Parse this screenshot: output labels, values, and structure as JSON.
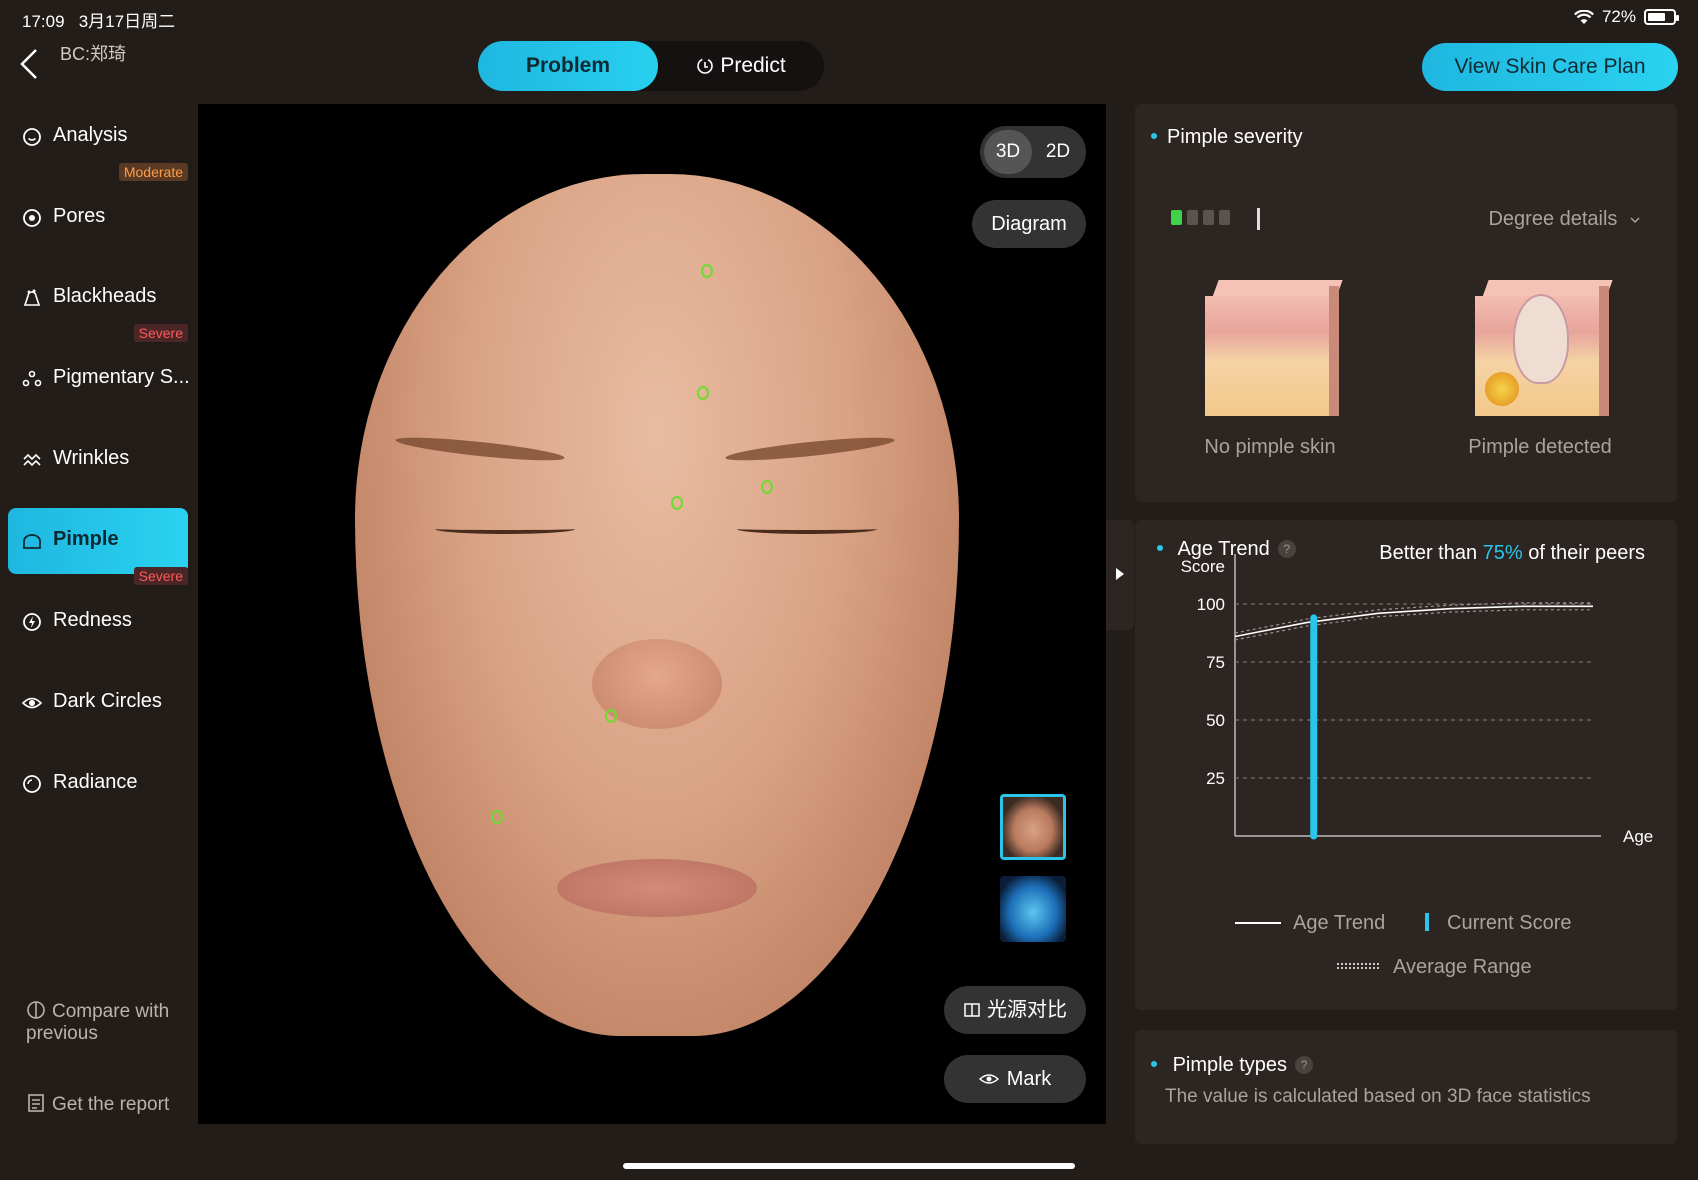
{
  "status": {
    "time": "17:09",
    "date": "3月17日周二",
    "battery": "72%",
    "battery_level": 0.72
  },
  "header": {
    "customer": "BC:郑琦",
    "tabs": [
      {
        "label": "Problem"
      },
      {
        "label": "Predict"
      }
    ],
    "plan_button": "View Skin Care Plan"
  },
  "sidebar": {
    "items": [
      {
        "label": "Analysis",
        "icon": "face-smile-icon",
        "badge": ""
      },
      {
        "label": "Pores",
        "icon": "pores-icon",
        "badge": "Moderate"
      },
      {
        "label": "Blackheads",
        "icon": "blackheads-icon",
        "badge": ""
      },
      {
        "label": "Pigmentary S...",
        "icon": "pigment-icon",
        "badge": "Severe"
      },
      {
        "label": "Wrinkles",
        "icon": "wrinkles-icon",
        "badge": ""
      },
      {
        "label": "Pimple",
        "icon": "pimple-icon",
        "badge": ""
      },
      {
        "label": "Redness",
        "icon": "redness-icon",
        "badge": "Severe"
      },
      {
        "label": "Dark Circles",
        "icon": "eye-icon",
        "badge": ""
      },
      {
        "label": "Radiance",
        "icon": "radiance-icon",
        "badge": ""
      }
    ],
    "compare": "Compare with previous",
    "report": "Get the report"
  },
  "viewer": {
    "mode_3d": "3D",
    "mode_2d": "2D",
    "diagram": "Diagram",
    "light_compare": "光源对比",
    "mark": "Mark"
  },
  "severity": {
    "title": "Pimple severity",
    "level": 1,
    "levels": 4,
    "degree_details": "Degree details",
    "no_pimple": "No pimple skin",
    "pimple_detected": "Pimple detected"
  },
  "age_trend": {
    "title": "Age Trend",
    "help": "?",
    "better_prefix": "Better than ",
    "better_pct": "75%",
    "better_suffix": " of their peers",
    "legend_trend": "Age Trend",
    "legend_current": "Current Score",
    "legend_range": "Average Range"
  },
  "chart_data": {
    "type": "line",
    "ylabel": "Score",
    "xlabel": "Age",
    "xlim": [
      20,
      70
    ],
    "ylim": [
      0,
      100
    ],
    "xticks": [
      "20",
      "30",
      "40",
      "50",
      "60",
      "70"
    ],
    "yticks": [
      "25",
      "50",
      "75",
      "100"
    ],
    "series": [
      {
        "name": "Age Trend",
        "x": [
          20,
          25,
          30,
          40,
          50,
          60,
          70
        ],
        "values": [
          86,
          89,
          92,
          96,
          98,
          99,
          99
        ]
      }
    ],
    "current_score": {
      "x": 31,
      "value": 94
    },
    "colors": {
      "current": "#29c6ea",
      "trend": "#ffffff",
      "range": "#9a928e"
    }
  },
  "types": {
    "title": "Pimple types",
    "help": "?",
    "description": "The value is calculated based on 3D face statistics"
  },
  "colors": {
    "accent": "#29c6ea",
    "moderate": "#ff9d4a",
    "severe": "#ff5a5a",
    "marker": "#6ddc2e"
  }
}
